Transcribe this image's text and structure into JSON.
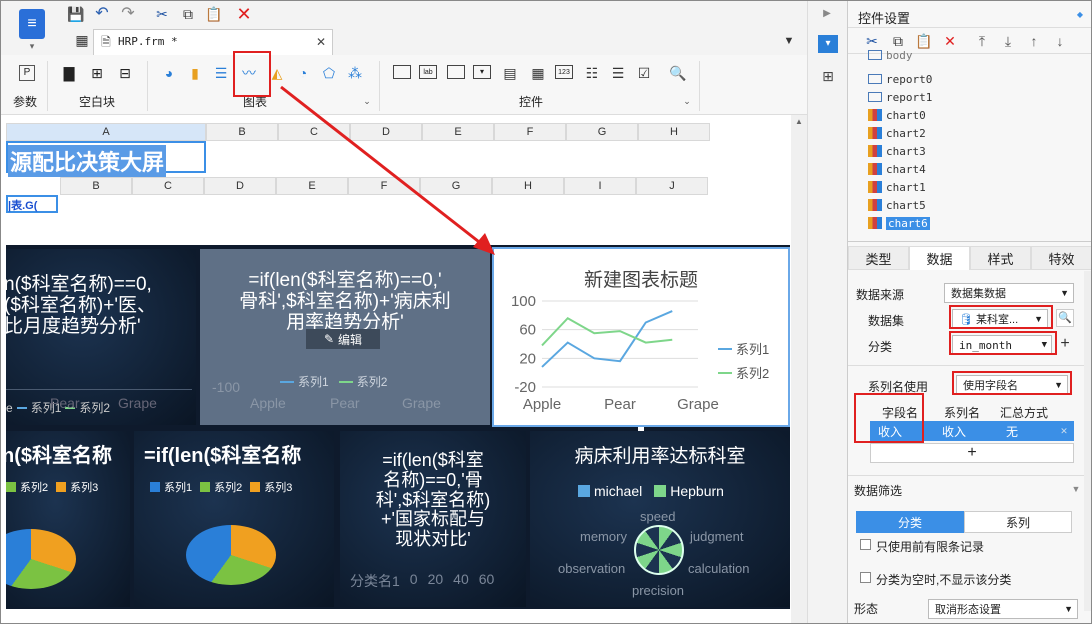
{
  "toolbar": {
    "file_tab": "HRP.frm *"
  },
  "ribbon": {
    "group_param": "参数",
    "group_blank": "空白块",
    "group_chart": "图表",
    "group_control": "控件"
  },
  "sheet": {
    "cols_top": [
      "A",
      "B",
      "C",
      "D",
      "E",
      "F",
      "G",
      "H"
    ],
    "cols_inner": [
      "B",
      "C",
      "D",
      "E",
      "F",
      "G",
      "H",
      "I",
      "J"
    ],
    "title_cell": "源配比决策大屏",
    "formula_cell": "|表.G("
  },
  "dashboard": {
    "p1_text": "n($科室名称)==0,\n($科室名称)+'医、\n比月度趋势分析'",
    "p1_legend": [
      "e",
      "系列1",
      "系列2"
    ],
    "p1_axis": [
      "Pear",
      "Grape"
    ],
    "p2_text": "=if(len($科室名称)==0,'\n骨科',$科室名称)+'病床利\n用率趋势分析'",
    "p2_edit": "编辑",
    "p2_axis": [
      "-100",
      "Apple",
      "Pear",
      "Grape"
    ],
    "p2_legend": [
      "系列1",
      "系列2"
    ],
    "new_chart": {
      "title": "新建图表标题",
      "legend": [
        "系列1",
        "系列2"
      ]
    },
    "p4_text": "n($科室名称",
    "p4_legend": [
      "系列2",
      "系列3"
    ],
    "p5_text": "=if(len($科室名称",
    "p5_legend": [
      "系列1",
      "系列2",
      "系列3"
    ],
    "p6_text": "=if(len($科室\n名称)==0,'骨\n科',$科室名称)\n+'国家标配与\n现状对比'",
    "p6_axis": [
      "分类名1",
      "0",
      "20",
      "40",
      "60"
    ],
    "p7_title": "病床利用率达标科室",
    "p7_legend": [
      "michael",
      "Hepburn"
    ],
    "p7_radar": [
      "speed",
      "judgment",
      "calculation",
      "precision",
      "observation",
      "memory"
    ]
  },
  "chart_data": {
    "type": "line",
    "title": "新建图表标题",
    "categories": [
      "Apple",
      "Pear",
      "Grape"
    ],
    "ylim": [
      -20,
      100
    ],
    "yticks": [
      100,
      60,
      20,
      -20
    ],
    "ytick_labels_shown": [
      "100",
      "60",
      "20",
      "-20"
    ],
    "x_dense": [
      0,
      0.33,
      0.67,
      1,
      1.33,
      1.67,
      2
    ],
    "series": [
      {
        "name": "系列1",
        "color": "#5aa7e0",
        "values": [
          8,
          42,
          20,
          16,
          70,
          86,
          null
        ]
      },
      {
        "name": "系列2",
        "color": "#7ed68a",
        "values": [
          38,
          76,
          55,
          58,
          42,
          46,
          null
        ]
      }
    ]
  },
  "props": {
    "title": "控件设置",
    "tree": [
      "body",
      "report0",
      "report1",
      "chart0",
      "chart2",
      "chart3",
      "chart4",
      "chart1",
      "chart5",
      "chart6"
    ],
    "tabs": [
      "类型",
      "数据",
      "样式",
      "特效"
    ],
    "data_source_label": "数据来源",
    "data_source_value": "数据集数据",
    "dataset_label": "数据集",
    "dataset_value": "某科室...",
    "category_label": "分类",
    "category_value": "in_month",
    "series_name_label": "系列名使用",
    "series_name_value": "使用字段名",
    "grid_headers": [
      "字段名",
      "系列名",
      "汇总方式"
    ],
    "grid_row": [
      "收入",
      "收入",
      "无"
    ],
    "add_label": "+",
    "filter_title": "数据筛选",
    "filter_tabs": [
      "分类",
      "系列"
    ],
    "check1": "只使用前有限条记录",
    "check2": "分类为空时,不显示该分类",
    "shape_label": "形态",
    "shape_value": "取消形态设置"
  },
  "colors": {
    "accent": "#3b8fe6",
    "highlight_red": "#e02020"
  }
}
